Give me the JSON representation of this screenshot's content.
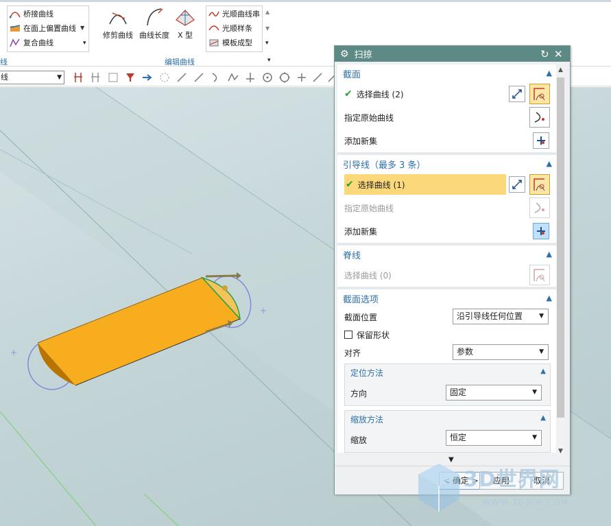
{
  "ribbon": {
    "curve_items": [
      "桥接曲线",
      "在面上偏置曲线",
      "复合曲线"
    ],
    "big_buttons": [
      "修剪曲线",
      "曲线长度",
      "X 型"
    ],
    "smooth_items": [
      "光顺曲线串",
      "光顺样条",
      "模板成型"
    ],
    "group_label": "编辑曲线",
    "left_group_label": "线"
  },
  "toolbar": {
    "filter_value": "线"
  },
  "dialog": {
    "title": "扫掠",
    "section_section": {
      "title": "截面",
      "select_curve": "选择曲线 (2)",
      "specify_origin": "指定原始曲线",
      "add_new_set": "添加新集"
    },
    "section_guide": {
      "title": "引导线（最多 3 条）",
      "select_curve": "选择曲线 (1)",
      "specify_origin": "指定原始曲线",
      "add_new_set": "添加新集"
    },
    "section_spine": {
      "title": "脊线",
      "select_curve": "选择曲线 (0)"
    },
    "section_options": {
      "title": "截面选项",
      "position_label": "截面位置",
      "position_value": "沿引导线任何位置",
      "preserve_shape": "保留形状",
      "align_label": "对齐",
      "align_value": "参数",
      "orientation_title": "定位方法",
      "direction_label": "方向",
      "direction_value": "固定",
      "scaling_title": "缩放方法",
      "scale_label": "缩放",
      "scale_value": "恒定"
    },
    "footer": {
      "ok": "< 确定 >",
      "apply": "应用",
      "cancel": "取消"
    }
  },
  "watermark": {
    "brand": "3D世界网",
    "url": "WWW.3DSJW.COM"
  },
  "colors": {
    "dialog_title_bg": "#5e8a85",
    "section_title": "#2f6fa6",
    "highlight": "#fbd879",
    "shape_fill": "#f5a800"
  }
}
